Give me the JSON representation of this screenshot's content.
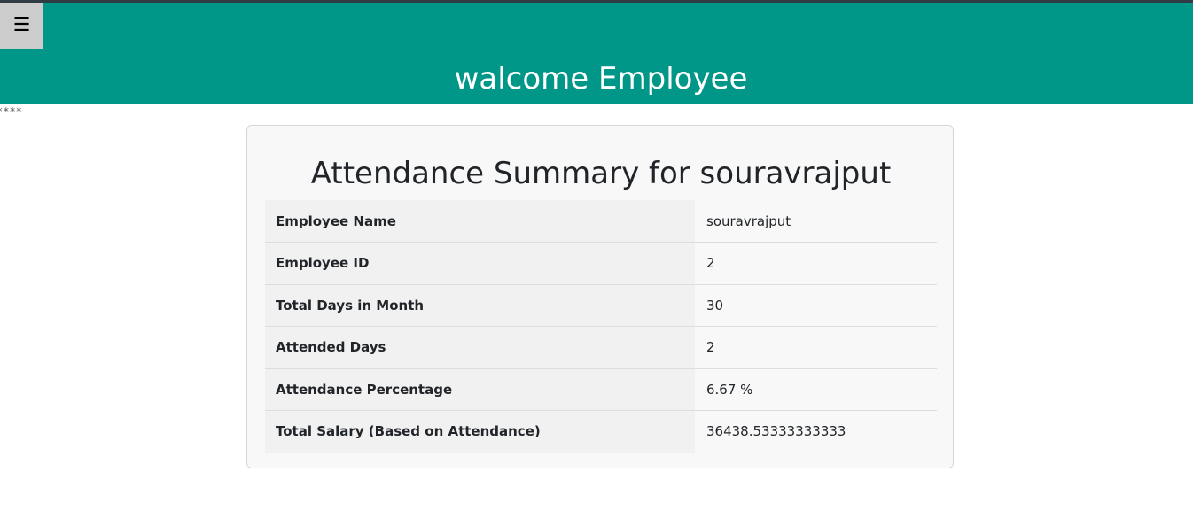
{
  "header": {
    "menu_icon": "☰",
    "title": "walcome Employee"
  },
  "stray_text": "****",
  "card": {
    "title": "Attendance Summary for souravrajput",
    "rows": [
      {
        "label": "Employee Name",
        "value": "souravrajput"
      },
      {
        "label": "Employee ID",
        "value": "2"
      },
      {
        "label": "Total Days in Month",
        "value": "30"
      },
      {
        "label": "Attended Days",
        "value": "2"
      },
      {
        "label": "Attendance Percentage",
        "value": "6.67 %"
      },
      {
        "label": "Total Salary (Based on Attendance)",
        "value": "36438.53333333333"
      }
    ]
  },
  "colors": {
    "header_bg": "#009688",
    "menu_button_bg": "#cccccc",
    "card_bg": "#f8f8f8",
    "label_cell_bg": "#f1f1f1"
  }
}
